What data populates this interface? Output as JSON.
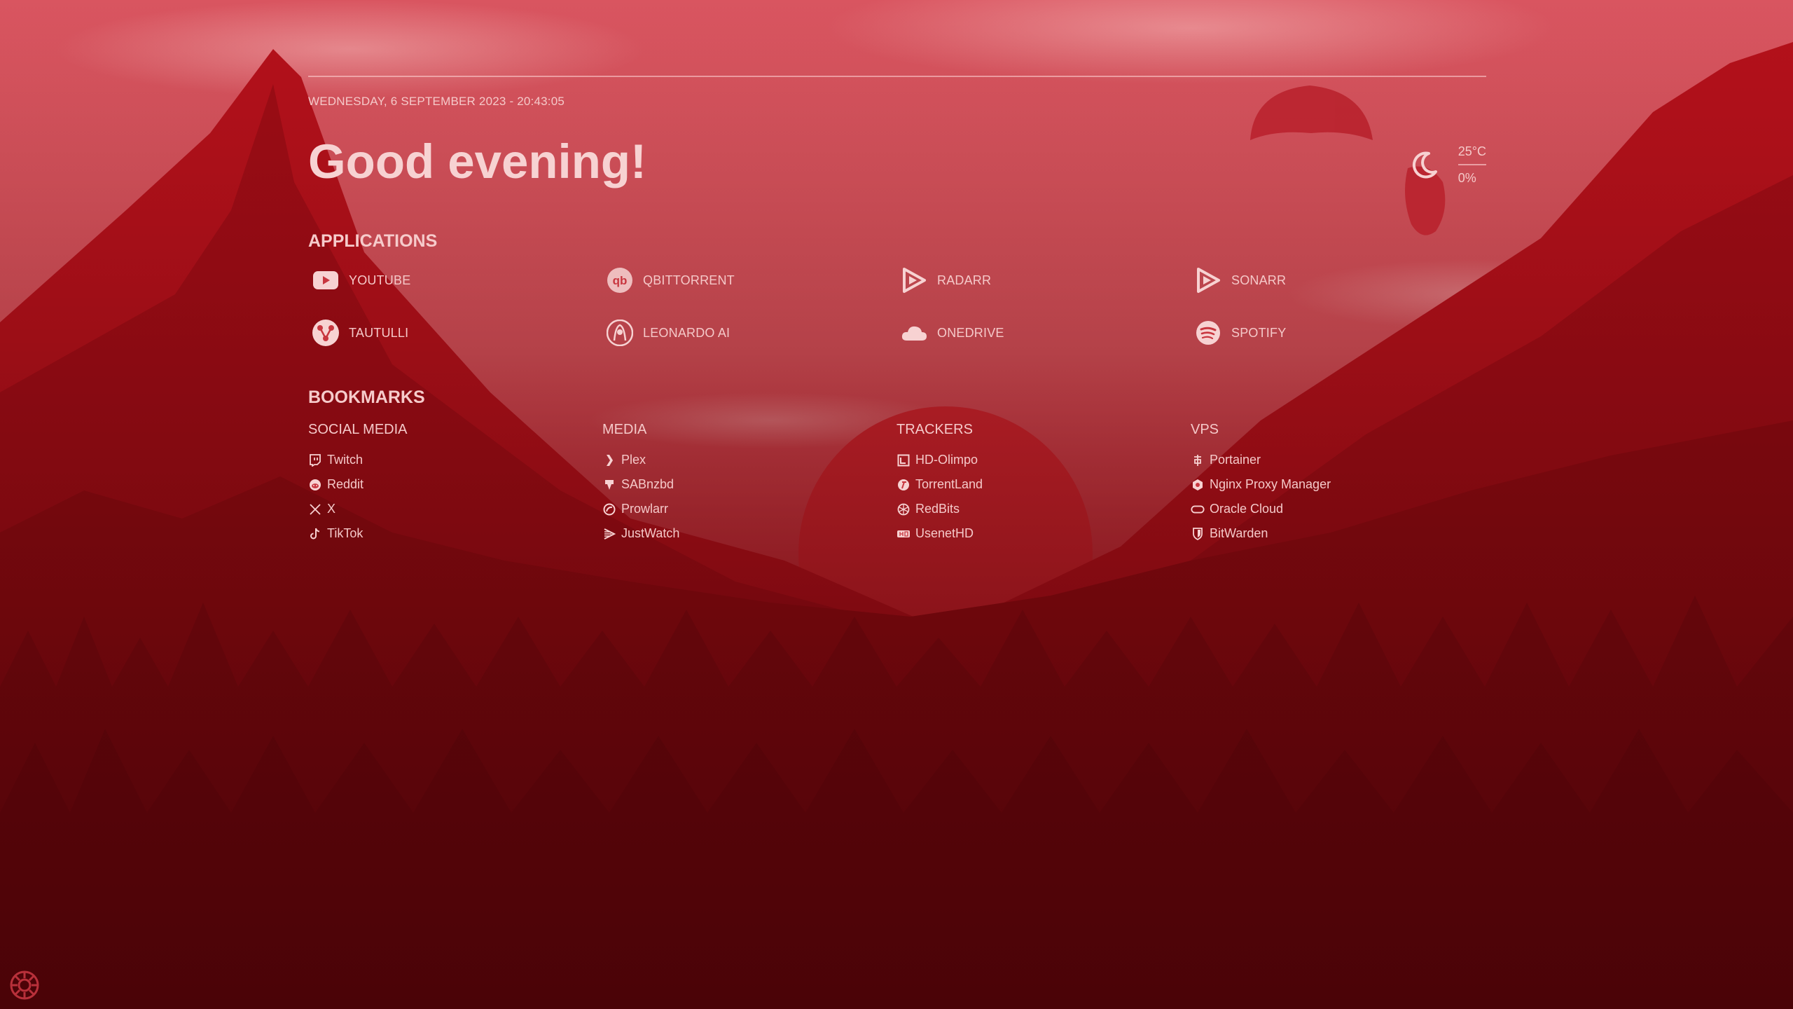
{
  "theme": {
    "accent": "#f7d2d2",
    "text": "#f5c9c9",
    "background": "#8e1016"
  },
  "header": {
    "datetime": "WEDNESDAY, 6 SEPTEMBER 2023 - 20:43:05",
    "greeting": "Good evening!"
  },
  "weather": {
    "icon": "moon-icon",
    "temperature": "25°C",
    "precipitation": "0%"
  },
  "applications": {
    "title": "APPLICATIONS",
    "items": [
      {
        "label": "YOUTUBE",
        "icon": "youtube-icon"
      },
      {
        "label": "QBITTORRENT",
        "icon": "qbittorrent-icon"
      },
      {
        "label": "RADARR",
        "icon": "radarr-icon"
      },
      {
        "label": "SONARR",
        "icon": "sonarr-icon"
      },
      {
        "label": "TAUTULLI",
        "icon": "tautulli-icon"
      },
      {
        "label": "LEONARDO AI",
        "icon": "leonardo-ai-icon"
      },
      {
        "label": "ONEDRIVE",
        "icon": "onedrive-icon"
      },
      {
        "label": "SPOTIFY",
        "icon": "spotify-icon"
      }
    ]
  },
  "bookmarks": {
    "title": "BOOKMARKS",
    "groups": [
      {
        "title": "SOCIAL MEDIA",
        "links": [
          {
            "label": "Twitch",
            "icon": "twitch-icon"
          },
          {
            "label": "Reddit",
            "icon": "reddit-icon"
          },
          {
            "label": "X",
            "icon": "x-icon"
          },
          {
            "label": "TikTok",
            "icon": "tiktok-icon"
          }
        ]
      },
      {
        "title": "MEDIA",
        "links": [
          {
            "label": "Plex",
            "icon": "plex-icon"
          },
          {
            "label": "SABnzbd",
            "icon": "sabnzbd-icon"
          },
          {
            "label": "Prowlarr",
            "icon": "prowlarr-icon"
          },
          {
            "label": "JustWatch",
            "icon": "justwatch-icon"
          }
        ]
      },
      {
        "title": "TRACKERS",
        "links": [
          {
            "label": "HD-Olimpo",
            "icon": "hd-olimpo-icon"
          },
          {
            "label": "TorrentLand",
            "icon": "torrentland-icon"
          },
          {
            "label": "RedBits",
            "icon": "redbits-icon"
          },
          {
            "label": "UsenetHD",
            "icon": "usenethd-icon"
          }
        ]
      },
      {
        "title": "VPS",
        "links": [
          {
            "label": "Portainer",
            "icon": "portainer-icon"
          },
          {
            "label": "Nginx Proxy Manager",
            "icon": "nginx-proxy-manager-icon"
          },
          {
            "label": "Oracle Cloud",
            "icon": "oracle-cloud-icon"
          },
          {
            "label": "BitWarden",
            "icon": "bitwarden-icon"
          }
        ]
      }
    ]
  },
  "settings": {
    "icon": "gear-icon"
  }
}
